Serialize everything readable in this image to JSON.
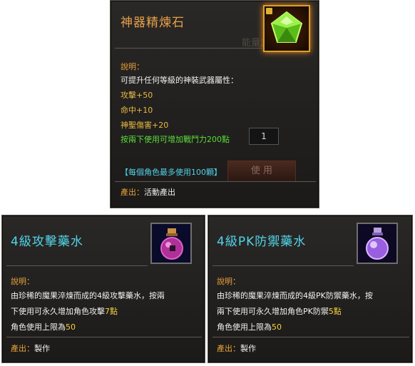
{
  "artifact_stone": {
    "title": "神器精煉石",
    "description_label": "說明：",
    "desc_line": "可提升任何等級的神裝武器屬性：",
    "stats": [
      "攻擊+50",
      "命中+10",
      "神聖傷害+20"
    ],
    "hint": "按兩下使用可增加戰鬥力200點",
    "limit": "【每個角色最多使用100顆】",
    "source_label": "產出：",
    "source_value": "活動產出",
    "bg_use": "使 用",
    "bg_book": "能量之書",
    "bg_quantity": "1"
  },
  "attack_potion": {
    "title": "4級攻擊藥水",
    "description_label": "說明：",
    "desc_line1": "由珍稀的魔果淬煉而成的4級攻擊藥水，按兩",
    "desc_line2_prefix": "下使用可永久增加角色攻擊",
    "desc_line2_value": "7點",
    "limit_prefix": "角色使用上限為",
    "limit_value": "50",
    "source_label": "產出：",
    "source_value": "製作"
  },
  "pk_defense_potion": {
    "title": "4級PK防禦藥水",
    "description_label": "說明：",
    "desc_line1": "由珍稀的魔果淬煉而成的4級PK防禦藥水，按",
    "desc_line2_prefix": "兩下使用可永久增加角色PK防禦",
    "desc_line2_value": "5點",
    "limit_prefix": "角色使用上限為",
    "limit_value": "50",
    "source_label": "產出：",
    "source_value": "製作"
  },
  "colors": {
    "orange": "#e8a23a",
    "green": "#5bdc3a",
    "cyan": "#51d4e8",
    "yellow": "#f4d23e"
  }
}
